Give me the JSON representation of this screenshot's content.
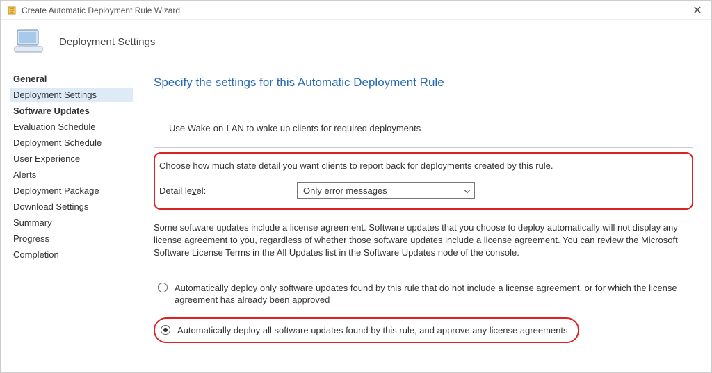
{
  "titlebar": {
    "title": "Create Automatic Deployment Rule Wizard"
  },
  "header": {
    "title": "Deployment Settings"
  },
  "sidebar": {
    "items": [
      {
        "label": "General",
        "bold": true,
        "active": false
      },
      {
        "label": "Deployment Settings",
        "bold": false,
        "active": true
      },
      {
        "label": "Software Updates",
        "bold": true,
        "active": false
      },
      {
        "label": "Evaluation Schedule",
        "bold": false,
        "active": false
      },
      {
        "label": "Deployment Schedule",
        "bold": false,
        "active": false
      },
      {
        "label": "User Experience",
        "bold": false,
        "active": false
      },
      {
        "label": "Alerts",
        "bold": false,
        "active": false
      },
      {
        "label": "Deployment Package",
        "bold": false,
        "active": false
      },
      {
        "label": "Download Settings",
        "bold": false,
        "active": false
      },
      {
        "label": "Summary",
        "bold": false,
        "active": false
      },
      {
        "label": "Progress",
        "bold": false,
        "active": false
      },
      {
        "label": "Completion",
        "bold": false,
        "active": false
      }
    ]
  },
  "main": {
    "heading": "Specify the settings for this Automatic Deployment Rule",
    "wol_checkbox_label": "Use Wake-on-LAN to wake up clients for required deployments",
    "state_detail_text": "Choose how much state detail you want clients to report back for deployments created by this rule.",
    "detail_level_label_pre": "Detail le",
    "detail_level_label_u": "v",
    "detail_level_label_post": "el:",
    "detail_level_value": "Only error messages",
    "license_info_text": "Some software updates include a license agreement. Software updates that you choose to deploy automatically will not display any license agreement to you, regardless of whether those software updates include a license agreement. You can review the Microsoft Software License Terms in the All Updates list in the Software Updates node of the console.",
    "radio1_label": "Automatically deploy only software updates found by this rule that do not include a license agreement, or for which the license agreement has already been approved",
    "radio2_label": "Automatically deploy all software updates found by this rule, and approve any license agreements"
  }
}
